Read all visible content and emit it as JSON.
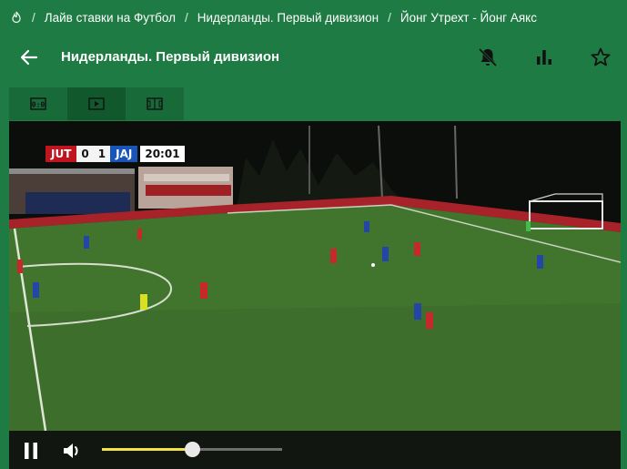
{
  "breadcrumb": {
    "items": [
      "Лайв ставки на Футбол",
      "Нидерланды. Первый дивизион",
      "Йонг Утрехт - Йонг Аякс"
    ]
  },
  "header": {
    "title": "Нидерланды. Первый дивизион"
  },
  "tabs": [
    {
      "name": "scoreboard",
      "active": false
    },
    {
      "name": "video",
      "active": true
    },
    {
      "name": "stats-board",
      "active": false
    }
  ],
  "video": {
    "home_code": "JUT",
    "home_score": "0",
    "away_score": "1",
    "away_code": "JAJ",
    "clock": "20:01"
  },
  "player": {
    "volume_level": 0.5
  },
  "colors": {
    "background": "#1e7b43",
    "tab_active": "#11592d",
    "volume_fill": "#f0e34b"
  }
}
